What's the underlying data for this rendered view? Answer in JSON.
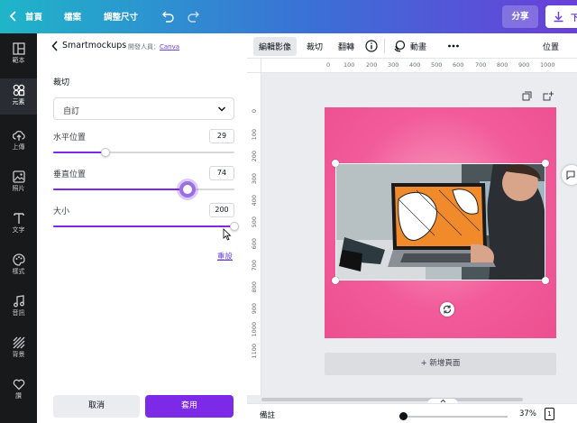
{
  "topbar": {
    "home": "首頁",
    "file": "檔案",
    "resize": "調整尺寸",
    "share": "分享",
    "download": "下"
  },
  "rail": [
    {
      "label": "範本",
      "icon": "layout-icon"
    },
    {
      "label": "元素",
      "icon": "shapes-icon",
      "active": true
    },
    {
      "label": "上傳",
      "icon": "cloud-upload-icon"
    },
    {
      "label": "照片",
      "icon": "photo-icon"
    },
    {
      "label": "文字",
      "icon": "text-icon"
    },
    {
      "label": "樣式",
      "icon": "palette-icon"
    },
    {
      "label": "音訊",
      "icon": "music-icon"
    },
    {
      "label": "背景",
      "icon": "pattern-icon"
    },
    {
      "label": "讚",
      "icon": "heart-icon"
    }
  ],
  "panel": {
    "title": "Smartmockups",
    "developer_prefix": "開發人員：",
    "developer_link": "Canva",
    "section_title": "裁切",
    "crop_select": "自訂",
    "sliders": [
      {
        "label": "水平位置",
        "value": "29",
        "fraction": 0.29
      },
      {
        "label": "垂直位置",
        "value": "74",
        "fraction": 0.74
      },
      {
        "label": "大小",
        "value": "200",
        "fraction": 1.0
      }
    ],
    "reset": "重設",
    "cancel": "取消",
    "apply": "套用"
  },
  "toolbar": {
    "edit_image": "編輯影像",
    "crop": "裁切",
    "flip": "翻轉",
    "animate": "動畫",
    "position": "位置"
  },
  "ruler_top": [
    "0",
    "100",
    "200",
    "300",
    "400",
    "500",
    "600",
    "700",
    "800",
    "900",
    "1000"
  ],
  "ruler_left": [
    "0",
    "100",
    "200",
    "300",
    "400",
    "500",
    "600",
    "700",
    "800",
    "900",
    "1000",
    "1100"
  ],
  "canvas": {
    "add_page": "+ 新增頁面",
    "page_color": "#f25b9a"
  },
  "footer": {
    "notes": "備註",
    "zoom": "37%",
    "page_count": "1",
    "zoom_fraction": 0.0
  },
  "colors": {
    "accent": "#7d2ae8",
    "rail_bg": "#18191b"
  }
}
